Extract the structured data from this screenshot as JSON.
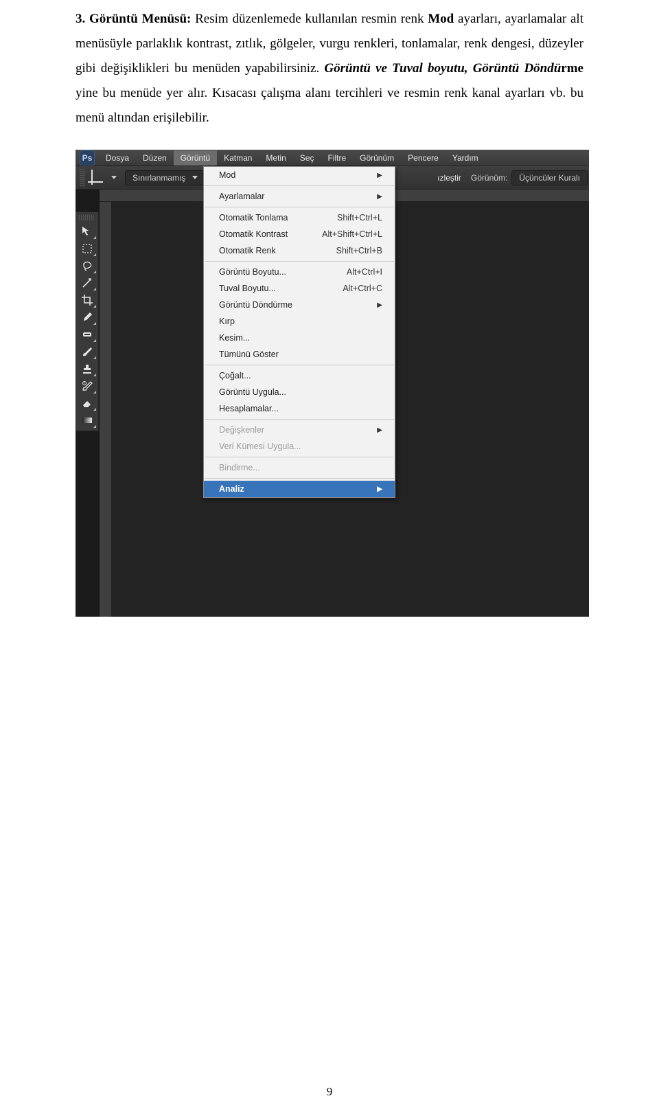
{
  "doc": {
    "line1_prefix": "3.  ",
    "line1_bold": "Görüntü Menüsü:",
    "line1_rest": " Resim düzenlemede kullanılan resmin renk ",
    "line1_bold2": "Mod",
    "line1_rest2": " ayarları, ayarlamalar alt menüsüyle parlaklık kontrast, zıtlık, gölgeler, vurgu renkleri, tonlamalar, renk dengesi, düzeyler gibi değişiklikleri bu menüden yapabilirsiniz. ",
    "italic_part": "Görüntü ve Tuval boyutu, Görüntü Döndü",
    "bold_rme": "rme",
    "rest3": " yine bu menüde yer alır. Kısacası çalışma alanı tercihleri ve resmin renk kanal ayarları vb. bu menü altından erişilebilir."
  },
  "ps": {
    "logo": "Ps",
    "menus": [
      "Dosya",
      "Düzen",
      "Görüntü",
      "Katman",
      "Metin",
      "Seç",
      "Filtre",
      "Görünüm",
      "Pencere",
      "Yardım"
    ],
    "optbar": {
      "unrestricted": "Sınırlanmamış",
      "straighten_suffix": "ızleştir",
      "view_label": "Görünüm:",
      "view_value": "Üçüncüler Kuralı"
    },
    "dropdown": [
      {
        "label": "Mod",
        "sub": true
      },
      {
        "sep": true
      },
      {
        "label": "Ayarlamalar",
        "sub": true
      },
      {
        "sep": true
      },
      {
        "label": "Otomatik Tonlama",
        "shortcut": "Shift+Ctrl+L"
      },
      {
        "label": "Otomatik Kontrast",
        "shortcut": "Alt+Shift+Ctrl+L"
      },
      {
        "label": "Otomatik Renk",
        "shortcut": "Shift+Ctrl+B"
      },
      {
        "sep": true
      },
      {
        "label": "Görüntü Boyutu...",
        "shortcut": "Alt+Ctrl+I"
      },
      {
        "label": "Tuval Boyutu...",
        "shortcut": "Alt+Ctrl+C"
      },
      {
        "label": "Görüntü Döndürme",
        "sub": true
      },
      {
        "label": "Kırp"
      },
      {
        "label": "Kesim..."
      },
      {
        "label": "Tümünü Göster"
      },
      {
        "sep": true
      },
      {
        "label": "Çoğalt..."
      },
      {
        "label": "Görüntü Uygula..."
      },
      {
        "label": "Hesaplamalar..."
      },
      {
        "sep": true
      },
      {
        "label": "Değişkenler",
        "sub": true,
        "disabled": true
      },
      {
        "label": "Veri Kümesi Uygula...",
        "disabled": true
      },
      {
        "sep": true
      },
      {
        "label": "Bindirme...",
        "disabled": true
      },
      {
        "sep": true
      },
      {
        "label": "Analiz",
        "sub": true,
        "selected": true
      }
    ]
  },
  "page_number": "9",
  "tool_names": [
    "move",
    "marquee",
    "lasso",
    "wand",
    "crop",
    "eyedropper",
    "healing",
    "brush",
    "stamp",
    "history",
    "eraser",
    "gradient"
  ]
}
